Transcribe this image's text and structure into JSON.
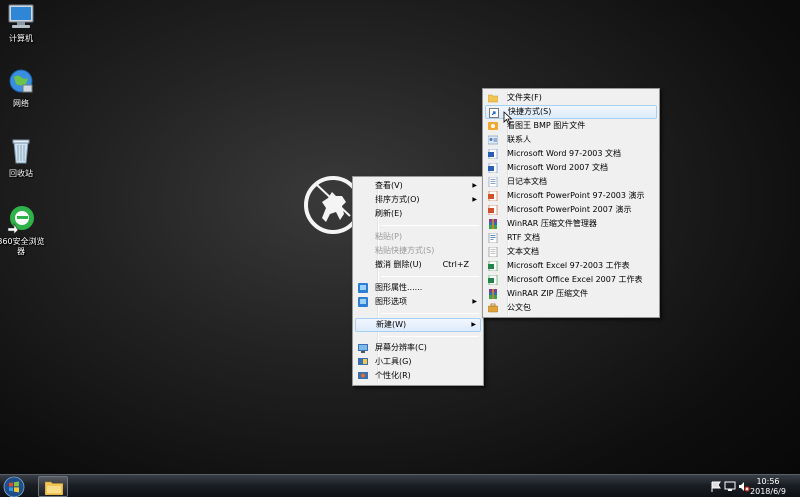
{
  "desktop": {
    "icons": [
      {
        "label": "计算机"
      },
      {
        "label": "网络"
      },
      {
        "label": "回收站"
      },
      {
        "label": "360安全浏览器"
      }
    ]
  },
  "context_menu": {
    "items": [
      {
        "label": "查看(V)",
        "submenu": true
      },
      {
        "label": "排序方式(O)",
        "submenu": true
      },
      {
        "label": "刷新(E)"
      },
      {
        "label": "粘贴(P)",
        "disabled": true
      },
      {
        "label": "粘贴快捷方式(S)",
        "disabled": true
      },
      {
        "label": "撤消 删除(U)",
        "shortcut": "Ctrl+Z"
      },
      {
        "label": "图形属性......"
      },
      {
        "label": "图形选项",
        "submenu": true
      },
      {
        "label": "新建(W)",
        "submenu": true,
        "highlighted": true
      },
      {
        "label": "屏幕分辨率(C)"
      },
      {
        "label": "小工具(G)"
      },
      {
        "label": "个性化(R)"
      }
    ]
  },
  "new_submenu": {
    "items": [
      {
        "label": "文件夹(F)",
        "icon": "folder-icon"
      },
      {
        "label": "快捷方式(S)",
        "icon": "shortcut-icon",
        "highlighted": true
      },
      {
        "label": "看图王 BMP 图片文件",
        "icon": "bmp-icon"
      },
      {
        "label": "联系人",
        "icon": "contact-icon"
      },
      {
        "label": "Microsoft Word 97-2003 文档",
        "icon": "word-icon"
      },
      {
        "label": "Microsoft Word 2007 文档",
        "icon": "word-icon"
      },
      {
        "label": "日记本文档",
        "icon": "journal-icon"
      },
      {
        "label": "Microsoft PowerPoint 97-2003 演示",
        "icon": "powerpoint-icon"
      },
      {
        "label": "Microsoft PowerPoint 2007 演示",
        "icon": "powerpoint-icon"
      },
      {
        "label": "WinRAR 压缩文件管理器",
        "icon": "winrar-icon"
      },
      {
        "label": "RTF 文档",
        "icon": "rtf-icon"
      },
      {
        "label": "文本文档",
        "icon": "text-icon"
      },
      {
        "label": "Microsoft Excel 97-2003 工作表",
        "icon": "excel-icon"
      },
      {
        "label": "Microsoft Office Excel 2007 工作表",
        "icon": "excel-icon"
      },
      {
        "label": "WinRAR ZIP 压缩文件",
        "icon": "winrar-zip-icon"
      },
      {
        "label": "公文包",
        "icon": "briefcase-icon"
      }
    ]
  },
  "taskbar": {
    "time": "10:56",
    "date": "2018/6/9"
  },
  "colors": {
    "menu_bg": "#f0f0f0",
    "menu_highlight": "#dcebfc",
    "taskbar": "#1b1f25"
  }
}
